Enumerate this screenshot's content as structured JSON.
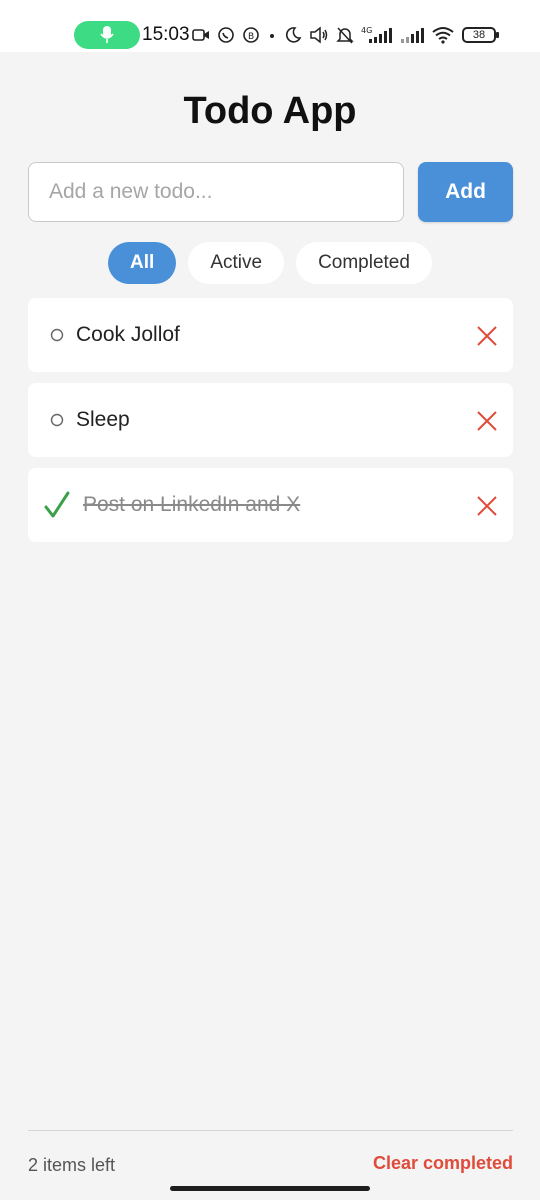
{
  "status_bar": {
    "time": "15:03",
    "network": "4G",
    "battery": "38",
    "accent": "#3ddc84"
  },
  "app": {
    "title": "Todo App",
    "input_placeholder": "Add a new todo...",
    "add_label": "Add",
    "accent": "#4a90d9"
  },
  "filters": [
    {
      "label": "All",
      "active": true
    },
    {
      "label": "Active",
      "active": false
    },
    {
      "label": "Completed",
      "active": false
    }
  ],
  "todos": [
    {
      "text": "Cook Jollof",
      "completed": false
    },
    {
      "text": "Sleep",
      "completed": false
    },
    {
      "text": "Post on LinkedIn and X",
      "completed": true
    }
  ],
  "footer": {
    "items_left": "2 items left",
    "clear_label": "Clear completed",
    "clear_color": "#e04b3a"
  }
}
